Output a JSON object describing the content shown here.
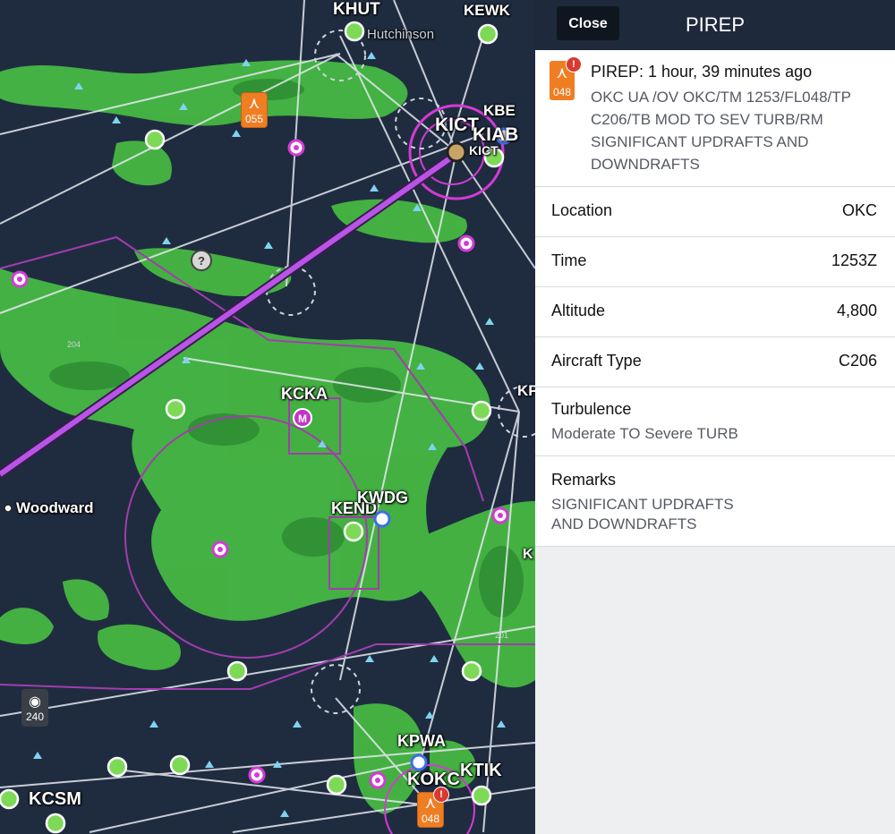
{
  "map": {
    "airports": [
      {
        "name": "KHUT",
        "label": "KHUT"
      },
      {
        "name": "KEWK",
        "label": "KEWK"
      },
      {
        "name": "hutchinson",
        "label": "Hutchinson"
      },
      {
        "name": "KICT",
        "label": "KICT"
      },
      {
        "name": "KIAB",
        "label": "KIAB"
      },
      {
        "name": "KBE",
        "label": "KBE"
      },
      {
        "name": "KICT-small",
        "label": "KICT"
      },
      {
        "name": "KCKA",
        "label": "KCKA"
      },
      {
        "name": "KEND",
        "label": "KEND"
      },
      {
        "name": "KWDG",
        "label": "KWDG"
      },
      {
        "name": "KCSM",
        "label": "KCSM"
      },
      {
        "name": "KOKC",
        "label": "KOKC"
      },
      {
        "name": "KTIK",
        "label": "KTIK"
      },
      {
        "name": "KPWA",
        "label": "KPWA"
      },
      {
        "name": "woodward",
        "label": "Woodward"
      },
      {
        "name": "KP-edge",
        "label": "KP"
      },
      {
        "name": "K-edge",
        "label": "K"
      }
    ],
    "pirep_badges": [
      {
        "name": "pirep-055",
        "altitude": "055",
        "alert": false
      },
      {
        "name": "pirep-048",
        "altitude": "048",
        "alert": true
      }
    ],
    "visibility_badge": {
      "value": "240"
    },
    "unknown_badge": "?",
    "airspace_label_204": "204",
    "airspace_label_201": "201"
  },
  "panel": {
    "close_label": "Close",
    "title": "PIREP",
    "header": {
      "icon_altitude": "048",
      "alert": "!",
      "title": "PIREP: 1 hour, 39 minutes ago",
      "body": "OKC UA /OV OKC/TM 1253/FL048/TP C206/TB MOD TO SEV TURB/RM SIGNIFICANT UPDRAFTS AND DOWNDRAFTS"
    },
    "rows": [
      {
        "key": "Location",
        "value": "OKC"
      },
      {
        "key": "Time",
        "value": "1253Z"
      },
      {
        "key": "Altitude",
        "value": "4,800"
      },
      {
        "key": "Aircraft Type",
        "value": "C206"
      }
    ],
    "turbulence": {
      "key": "Turbulence",
      "value": "Moderate TO Severe TURB"
    },
    "remarks": {
      "key": "Remarks",
      "value": "SIGNIFICANT UPDRAFTS\nAND DOWNDRAFTS"
    }
  },
  "colors": {
    "map_bg": "#1f2c40",
    "weather_light": "#4fc94a",
    "weather_dark": "#2f9a34",
    "route": "#a54bd6",
    "airport_green": "#7ed957",
    "magenta": "#d43ad6",
    "pirep": "#ef7d22"
  }
}
